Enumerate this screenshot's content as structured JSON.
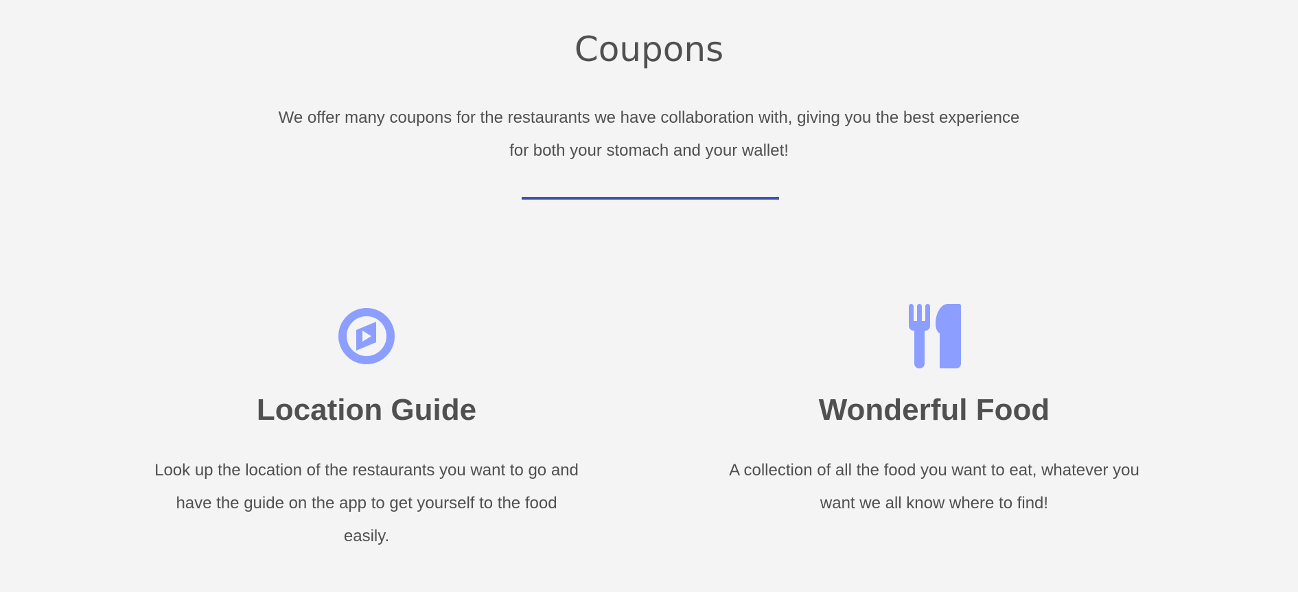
{
  "section": {
    "title": "Coupons",
    "intro": "We offer many coupons for the restaurants we have collaboration with, giving you the best experience for both your stomach and your wallet!",
    "accent_color": "#3f51b5",
    "icon_color": "#8c9eff"
  },
  "features": [
    {
      "icon": "compass-icon",
      "title": "Location Guide",
      "text": "Look up the location of the restaurants you want to go and have the guide on the app to get yourself to the food easily."
    },
    {
      "icon": "fork-knife-icon",
      "title": "Wonderful Food",
      "text": "A collection of all the food you want to eat, whatever you want we all know where to find!"
    }
  ]
}
